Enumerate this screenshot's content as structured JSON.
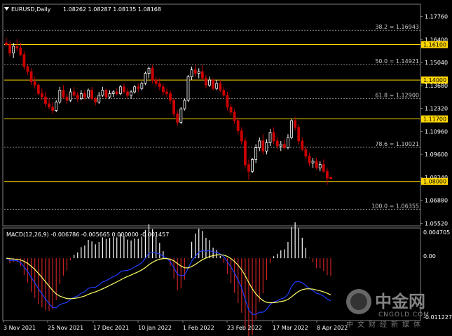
{
  "header": {
    "symbol": "EURUSD,Daily",
    "ohlc": "1.08262 1.08287 1.08135 1.08168"
  },
  "macd": {
    "label": "MACD(12,26,9) -0.006786 -0.005665 0.000000 -0.001457",
    "scale_top": "0.004705",
    "scale_mid": "0.00",
    "scale_bottom": "-0.011227"
  },
  "price_axis": [
    "1.17760",
    "1.16400",
    "1.15040",
    "1.13680",
    "1.12320",
    "1.10960",
    "1.09600",
    "1.08240",
    "1.06880",
    "1.05520"
  ],
  "horizontal_levels": [
    {
      "label": "1.16100",
      "value": 1.161
    },
    {
      "label": "1.14000",
      "value": 1.14
    },
    {
      "label": "1.11700",
      "value": 1.117
    },
    {
      "label": "1.08000",
      "value": 1.08
    }
  ],
  "fib_levels": [
    {
      "label": "38.2 = 1.16943",
      "value": 1.16943
    },
    {
      "label": "50.0 = 1.14921",
      "value": 1.14921
    },
    {
      "label": "61.8 = 1.12900",
      "value": 1.129
    },
    {
      "label": "78.6 = 1.10021",
      "value": 1.10021
    },
    {
      "label": "100.0 = 1.06355",
      "value": 1.06355
    }
  ],
  "date_axis": [
    "3 Nov 2021",
    "25 Nov 2021",
    "17 Dec 2021",
    "10 Jan 2022",
    "1 Feb 2022",
    "23 Feb 2022",
    "17 Mar 2022",
    "8 Apr 2022"
  ],
  "colors": {
    "background": "#000000",
    "bull": "#ffffff",
    "bear": "#cc0000",
    "level": "#ffd700",
    "fib": "#888888",
    "macd_main": "#1e3cff",
    "macd_signal": "#ffff66",
    "macd_hist_pos": "#ffffff",
    "macd_hist_neg": "#cc2222"
  },
  "watermark": {
    "cn": "中金网",
    "en": "CNGOLD.COM",
    "sub": "中文财经新媒体"
  },
  "chart_data": {
    "type": "candlestick",
    "price_range": [
      1.0552,
      1.1844
    ],
    "candles": [
      [
        1.162,
        1.165,
        1.16,
        1.161
      ],
      [
        1.161,
        1.163,
        1.154,
        1.156
      ],
      [
        1.156,
        1.162,
        1.153,
        1.16
      ],
      [
        1.16,
        1.164,
        1.157,
        1.159
      ],
      [
        1.159,
        1.162,
        1.154,
        1.155
      ],
      [
        1.155,
        1.157,
        1.146,
        1.148
      ],
      [
        1.148,
        1.149,
        1.143,
        1.145
      ],
      [
        1.145,
        1.147,
        1.137,
        1.139
      ],
      [
        1.139,
        1.142,
        1.135,
        1.137
      ],
      [
        1.137,
        1.138,
        1.131,
        1.132
      ],
      [
        1.132,
        1.135,
        1.128,
        1.13
      ],
      [
        1.13,
        1.133,
        1.124,
        1.126
      ],
      [
        1.126,
        1.129,
        1.123,
        1.124
      ],
      [
        1.124,
        1.127,
        1.12,
        1.122
      ],
      [
        1.122,
        1.128,
        1.121,
        1.127
      ],
      [
        1.127,
        1.136,
        1.126,
        1.134
      ],
      [
        1.134,
        1.137,
        1.129,
        1.13
      ],
      [
        1.13,
        1.132,
        1.126,
        1.128
      ],
      [
        1.128,
        1.135,
        1.127,
        1.133
      ],
      [
        1.133,
        1.136,
        1.13,
        1.131
      ],
      [
        1.131,
        1.133,
        1.127,
        1.129
      ],
      [
        1.129,
        1.134,
        1.128,
        1.132
      ],
      [
        1.132,
        1.134,
        1.128,
        1.13
      ],
      [
        1.13,
        1.135,
        1.129,
        1.134
      ],
      [
        1.134,
        1.136,
        1.128,
        1.129
      ],
      [
        1.129,
        1.13,
        1.125,
        1.127
      ],
      [
        1.127,
        1.133,
        1.126,
        1.131
      ],
      [
        1.131,
        1.136,
        1.13,
        1.134
      ],
      [
        1.134,
        1.135,
        1.129,
        1.13
      ],
      [
        1.13,
        1.134,
        1.129,
        1.132
      ],
      [
        1.132,
        1.134,
        1.13,
        1.133
      ],
      [
        1.133,
        1.135,
        1.131,
        1.132
      ],
      [
        1.132,
        1.137,
        1.131,
        1.136
      ],
      [
        1.136,
        1.138,
        1.132,
        1.133
      ],
      [
        1.133,
        1.135,
        1.129,
        1.131
      ],
      [
        1.131,
        1.134,
        1.129,
        1.133
      ],
      [
        1.133,
        1.137,
        1.132,
        1.136
      ],
      [
        1.136,
        1.138,
        1.133,
        1.135
      ],
      [
        1.135,
        1.139,
        1.134,
        1.138
      ],
      [
        1.138,
        1.145,
        1.137,
        1.144
      ],
      [
        1.144,
        1.148,
        1.141,
        1.147
      ],
      [
        1.147,
        1.149,
        1.138,
        1.14
      ],
      [
        1.14,
        1.142,
        1.136,
        1.138
      ],
      [
        1.138,
        1.141,
        1.134,
        1.136
      ],
      [
        1.136,
        1.138,
        1.131,
        1.133
      ],
      [
        1.133,
        1.135,
        1.13,
        1.132
      ],
      [
        1.132,
        1.134,
        1.126,
        1.128
      ],
      [
        1.128,
        1.129,
        1.118,
        1.12
      ],
      [
        1.12,
        1.122,
        1.113,
        1.115
      ],
      [
        1.115,
        1.124,
        1.114,
        1.123
      ],
      [
        1.123,
        1.129,
        1.122,
        1.128
      ],
      [
        1.128,
        1.143,
        1.127,
        1.142
      ],
      [
        1.142,
        1.148,
        1.14,
        1.146
      ],
      [
        1.146,
        1.149,
        1.142,
        1.144
      ],
      [
        1.144,
        1.147,
        1.141,
        1.145
      ],
      [
        1.145,
        1.149,
        1.14,
        1.141
      ],
      [
        1.141,
        1.143,
        1.135,
        1.137
      ],
      [
        1.137,
        1.142,
        1.136,
        1.14
      ],
      [
        1.14,
        1.141,
        1.134,
        1.135
      ],
      [
        1.135,
        1.14,
        1.134,
        1.138
      ],
      [
        1.138,
        1.14,
        1.133,
        1.134
      ],
      [
        1.134,
        1.136,
        1.13,
        1.131
      ],
      [
        1.131,
        1.133,
        1.122,
        1.124
      ],
      [
        1.124,
        1.126,
        1.119,
        1.121
      ],
      [
        1.121,
        1.123,
        1.114,
        1.116
      ],
      [
        1.116,
        1.118,
        1.108,
        1.11
      ],
      [
        1.11,
        1.112,
        1.102,
        1.104
      ],
      [
        1.104,
        1.106,
        1.088,
        1.09
      ],
      [
        1.09,
        1.093,
        1.081,
        1.086
      ],
      [
        1.086,
        1.094,
        1.085,
        1.093
      ],
      [
        1.093,
        1.102,
        1.091,
        1.1
      ],
      [
        1.1,
        1.106,
        1.098,
        1.104
      ],
      [
        1.104,
        1.108,
        1.096,
        1.098
      ],
      [
        1.098,
        1.105,
        1.096,
        1.103
      ],
      [
        1.103,
        1.111,
        1.101,
        1.109
      ],
      [
        1.109,
        1.112,
        1.102,
        1.104
      ],
      [
        1.104,
        1.106,
        1.099,
        1.101
      ],
      [
        1.101,
        1.104,
        1.098,
        1.102
      ],
      [
        1.102,
        1.105,
        1.099,
        1.1
      ],
      [
        1.1,
        1.108,
        1.099,
        1.106
      ],
      [
        1.106,
        1.117,
        1.105,
        1.116
      ],
      [
        1.116,
        1.118,
        1.11,
        1.112
      ],
      [
        1.112,
        1.114,
        1.102,
        1.104
      ],
      [
        1.104,
        1.106,
        1.098,
        1.099
      ],
      [
        1.099,
        1.101,
        1.093,
        1.095
      ],
      [
        1.095,
        1.097,
        1.089,
        1.091
      ],
      [
        1.091,
        1.094,
        1.088,
        1.092
      ],
      [
        1.092,
        1.094,
        1.087,
        1.088
      ],
      [
        1.088,
        1.092,
        1.086,
        1.09
      ],
      [
        1.09,
        1.093,
        1.085,
        1.086
      ],
      [
        1.086,
        1.088,
        1.078,
        1.082
      ],
      [
        1.0826,
        1.0829,
        1.0814,
        1.0817
      ]
    ]
  }
}
